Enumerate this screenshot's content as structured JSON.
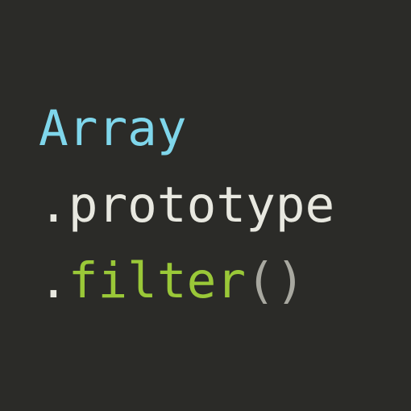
{
  "code": {
    "line1": {
      "className": "Array"
    },
    "line2": {
      "dot": ".",
      "property": "prototype"
    },
    "line3": {
      "dot": ".",
      "method": "filter",
      "parens": "()"
    }
  }
}
